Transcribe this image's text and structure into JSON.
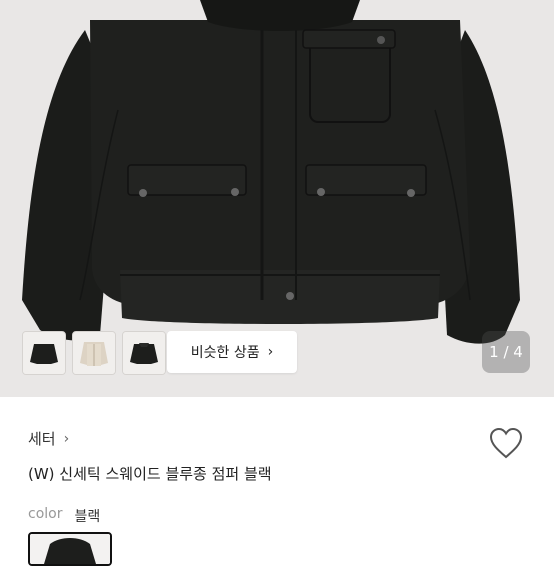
{
  "gallery": {
    "similar_button_label": "비슷한 상품",
    "counter": "1 / 4",
    "thumbnails": [
      "black-jacket",
      "beige-jacket",
      "black-jacket-back"
    ]
  },
  "product": {
    "category": "세터",
    "title": "(W) 신세틱 스웨이드 블루종 점퍼 블랙",
    "color_label": "color",
    "color_value": "블랙"
  },
  "icons": {
    "heart": "heart-outline-icon",
    "category_chevron": "chevron-right-icon",
    "similar_chevron": "chevron-right-icon"
  },
  "colors": {
    "hero_background": "#e9e7e6",
    "jacket": "#1d1e1c",
    "text_primary": "#222222",
    "text_muted": "#999999"
  }
}
